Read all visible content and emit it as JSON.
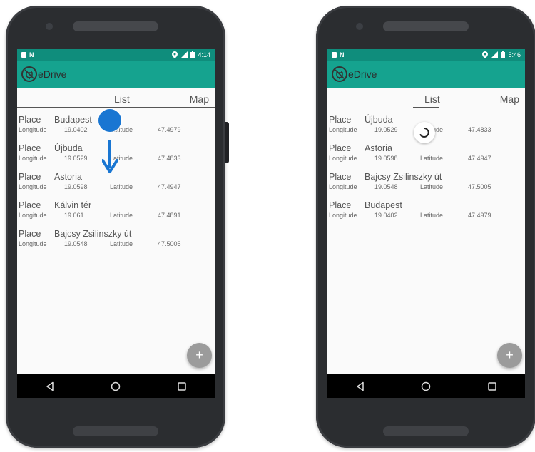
{
  "left": {
    "status": {
      "time": "4:14"
    },
    "app_title": "eDrive",
    "tabs": [
      {
        "label": "List"
      },
      {
        "label": "Map"
      }
    ],
    "rows": [
      {
        "place_label": "Place",
        "place": "Budapest",
        "lon_label": "Longitude",
        "lon": "19.0402",
        "lat_label": "Latitude",
        "lat": "47.4979"
      },
      {
        "place_label": "Place",
        "place": "Újbuda",
        "lon_label": "Longitude",
        "lon": "19.0529",
        "lat_label": "Latitude",
        "lat": "47.4833"
      },
      {
        "place_label": "Place",
        "place": "Astoria",
        "lon_label": "Longitude",
        "lon": "19.0598",
        "lat_label": "Latitude",
        "lat": "47.4947"
      },
      {
        "place_label": "Place",
        "place": "Kálvin tér",
        "lon_label": "Longitude",
        "lon": "19.061",
        "lat_label": "Latitude",
        "lat": "47.4891"
      },
      {
        "place_label": "Place",
        "place": "Bajcsy Zsilinszky út",
        "lon_label": "Longitude",
        "lon": "19.0548",
        "lat_label": "Latitude",
        "lat": "47.5005"
      }
    ],
    "fab": "+"
  },
  "right": {
    "status": {
      "time": "5:46"
    },
    "app_title": "eDrive",
    "tabs": [
      {
        "label": "List"
      },
      {
        "label": "Map"
      }
    ],
    "rows": [
      {
        "place_label": "Place",
        "place": "Újbuda",
        "lon_label": "Longitude",
        "lon": "19.0529",
        "lat_label": "Latitude",
        "lat": "47.4833"
      },
      {
        "place_label": "Place",
        "place": "Astoria",
        "lon_label": "Longitude",
        "lon": "19.0598",
        "lat_label": "Latitude",
        "lat": "47.4947"
      },
      {
        "place_label": "Place",
        "place": "Bajcsy Zsilinszky út",
        "lon_label": "Longitude",
        "lon": "19.0548",
        "lat_label": "Latitude",
        "lat": "47.5005"
      },
      {
        "place_label": "Place",
        "place": "Budapest",
        "lon_label": "Longitude",
        "lon": "19.0402",
        "lat_label": "Latitude",
        "lat": "47.4979"
      }
    ],
    "fab": "+"
  },
  "colors": {
    "status_bar": "#0f8d7c",
    "app_bar": "#15a38f",
    "touch_indicator": "#1976d2",
    "fab": "#9b9b9b"
  },
  "icons": [
    "sd-card-icon",
    "nfc-icon",
    "location-icon",
    "signal-icon",
    "battery-icon",
    "plug-icon",
    "back-icon",
    "home-icon",
    "recents-icon",
    "plus-icon",
    "arrow-down-icon",
    "loading-spinner-icon"
  ]
}
